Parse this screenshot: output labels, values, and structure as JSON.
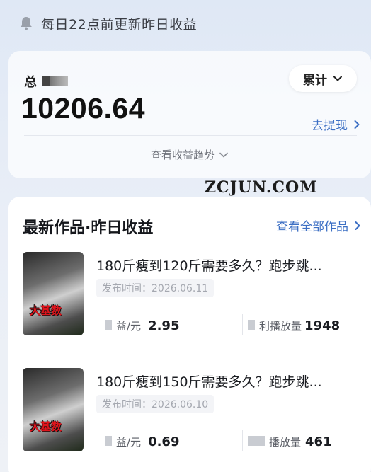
{
  "notice": {
    "text": "每日22点前更新昨日收益",
    "icon": "bell-icon"
  },
  "summary": {
    "total_label": "总",
    "period_label": "累计",
    "amount": "10206.64",
    "withdraw_label": "去提现",
    "trend_label": "查看收益趋势"
  },
  "watermark": "ZCJUN.COM",
  "works": {
    "title": "最新作品·昨日收益",
    "view_all_label": "查看全部作品",
    "items": [
      {
        "thumb_tag": "大基数",
        "title": "180斤瘦到120斤需要多久？跑步跳...",
        "pub_date": "发布时间：2026.06.11",
        "income_label": "益/元",
        "income_value": "2.95",
        "plays_label": "利播放量",
        "plays_value": "1948"
      },
      {
        "thumb_tag": "大基数",
        "title": "180斤瘦到150斤需要多久？跑步跳...",
        "pub_date": "发布时间：2026.06.10",
        "income_label": "益/元",
        "income_value": "0.69",
        "plays_label": "播放量",
        "plays_value": "461"
      }
    ]
  },
  "colors": {
    "accent": "#3c6fc4",
    "text": "#1b1d22",
    "muted": "#a5a8b0"
  }
}
